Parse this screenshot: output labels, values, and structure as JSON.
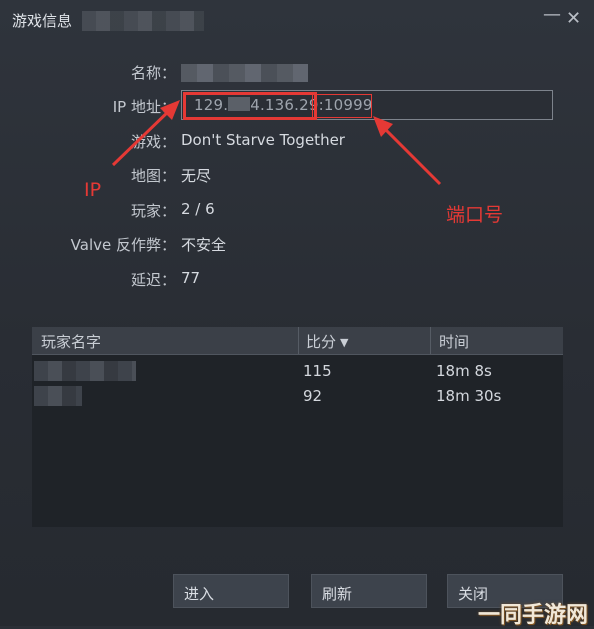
{
  "window": {
    "title": "游戏信息",
    "minimize_glyph": "—",
    "close_glyph": "✕"
  },
  "info": {
    "name": {
      "label": "名称："
    },
    "ip": {
      "label": "IP 地址：",
      "part1": "129.",
      "part2": "4.136.29:",
      "port": "10999"
    },
    "game": {
      "label": "游戏：",
      "value": "Don't Starve Together"
    },
    "map": {
      "label": "地图：",
      "value": "无尽"
    },
    "players": {
      "label": "玩家：",
      "value": "2 / 6"
    },
    "vac": {
      "label": "Valve 反作弊：",
      "value": "不安全"
    },
    "latency": {
      "label": "延迟：",
      "value": "77"
    }
  },
  "annotations": {
    "ip": "IP",
    "port": "端口号",
    "color": "#e53935"
  },
  "table": {
    "headers": {
      "name": "玩家名字",
      "score": "比分",
      "time": "时间"
    },
    "rows": [
      {
        "score": "115",
        "time": "18m 8s"
      },
      {
        "score": "92",
        "time": "18m 30s"
      }
    ]
  },
  "buttons": {
    "enter": "进入",
    "refresh": "刷新",
    "close": "关闭"
  },
  "watermark": "一同手游网"
}
